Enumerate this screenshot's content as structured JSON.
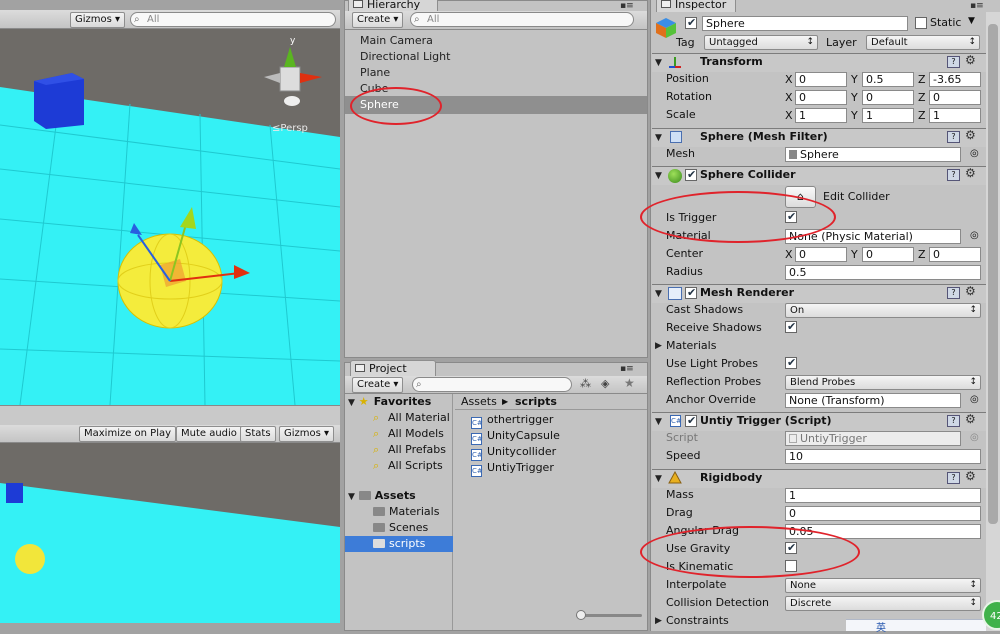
{
  "scene_view": {
    "gizmos_label": "Gizmos",
    "search_placeholder": "All",
    "persp_label": "Persp",
    "axis_y": "y"
  },
  "game_view": {
    "maximize_label": "Maximize on Play",
    "mute_label": "Mute audio",
    "stats_label": "Stats",
    "gizmos_label": "Gizmos"
  },
  "hierarchy": {
    "tab_label": "Hierarchy",
    "create_label": "Create",
    "search_placeholder": "All",
    "items": [
      "Main Camera",
      "Directional Light",
      "Plane",
      "Cube",
      "Sphere"
    ],
    "selected": "Sphere"
  },
  "project": {
    "tab_label": "Project",
    "create_label": "Create",
    "favorites_label": "Favorites",
    "favorites": [
      "All Material",
      "All Models",
      "All Prefabs",
      "All Scripts"
    ],
    "assets_label": "Assets",
    "folders": [
      "Materials",
      "Scenes",
      "scripts"
    ],
    "breadcrumb_root": "Assets",
    "breadcrumb_current": "scripts",
    "files": [
      "othertrigger",
      "UnityCapsule",
      "Unitycollider",
      "UntiyTrigger"
    ]
  },
  "inspector": {
    "tab_label": "Inspector",
    "object_name": "Sphere",
    "static_label": "Static",
    "tag_label": "Tag",
    "tag_value": "Untagged",
    "layer_label": "Layer",
    "layer_value": "Default",
    "transform": {
      "title": "Transform",
      "position_label": "Position",
      "rotation_label": "Rotation",
      "scale_label": "Scale",
      "position": [
        "0",
        "0.5",
        "-3.65"
      ],
      "rotation": [
        "0",
        "0",
        "0"
      ],
      "scale": [
        "1",
        "1",
        "1"
      ],
      "x": "X",
      "y": "Y",
      "z": "Z"
    },
    "mesh_filter": {
      "title": "Sphere (Mesh Filter)",
      "mesh_label": "Mesh",
      "mesh_value": "Sphere"
    },
    "sphere_collider": {
      "title": "Sphere Collider",
      "edit_label": "Edit Collider",
      "is_trigger_label": "Is Trigger",
      "material_label": "Material",
      "material_value": "None (Physic Material)",
      "center_label": "Center",
      "center": [
        "0",
        "0",
        "0"
      ],
      "radius_label": "Radius",
      "radius_value": "0.5"
    },
    "mesh_renderer": {
      "title": "Mesh Renderer",
      "cast_shadows_label": "Cast Shadows",
      "cast_shadows_value": "On",
      "receive_shadows_label": "Receive Shadows",
      "materials_label": "Materials",
      "use_light_probes_label": "Use Light Probes",
      "reflection_probes_label": "Reflection Probes",
      "reflection_probes_value": "Blend Probes",
      "anchor_override_label": "Anchor Override",
      "anchor_override_value": "None (Transform)"
    },
    "script_component": {
      "title": "Untiy Trigger (Script)",
      "script_label": "Script",
      "script_value": "UntiyTrigger",
      "speed_label": "Speed",
      "speed_value": "10"
    },
    "rigidbody": {
      "title": "Rigidbody",
      "mass_label": "Mass",
      "mass_value": "1",
      "drag_label": "Drag",
      "drag_value": "0",
      "angular_drag_label": "Angular Drag",
      "angular_drag_value": "0.05",
      "use_gravity_label": "Use Gravity",
      "is_kinematic_label": "Is Kinematic",
      "interpolate_label": "Interpolate",
      "interpolate_value": "None",
      "collision_label": "Collision Detection",
      "collision_value": "Discrete",
      "constraints_label": "Constraints"
    }
  },
  "tray": {
    "badge": "42",
    "ime_glyph": "英"
  },
  "colors": {
    "plane_cyan": "#34f1f5",
    "annotation_red": "#e0232b",
    "selection_gray": "#8f8f8f"
  }
}
